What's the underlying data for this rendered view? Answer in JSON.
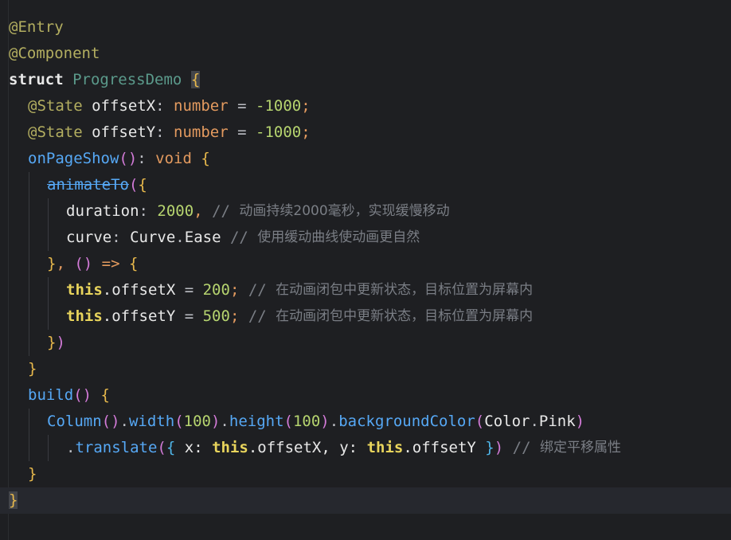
{
  "editor": {
    "theme_colors": {
      "background": "#1e1f22",
      "current_line": "#26282e",
      "annotation": "#b3ae60",
      "keyword": "#cf8e6d",
      "function": "#56a8f5",
      "number": "#b6d46f",
      "comment": "#7a7e85"
    },
    "current_line_number": 19,
    "lines": [
      {
        "tokens": [
          {
            "t": "@Entry",
            "c": "ann"
          }
        ]
      },
      {
        "tokens": [
          {
            "t": "@Component",
            "c": "ann"
          }
        ]
      },
      {
        "tokens": [
          {
            "t": "struct",
            "c": "white-bold"
          },
          {
            "t": " ",
            "c": "id"
          },
          {
            "t": "ProgressDemo",
            "c": "cls"
          },
          {
            "t": " ",
            "c": "id"
          },
          {
            "t": "{",
            "c": "brace-y hl"
          }
        ]
      },
      {
        "indent": 1,
        "tokens": [
          {
            "t": "@State",
            "c": "ann"
          },
          {
            "t": " offsetX",
            "c": "white"
          },
          {
            "t": ": ",
            "c": "op"
          },
          {
            "t": "number",
            "c": "orange"
          },
          {
            "t": " = ",
            "c": "op"
          },
          {
            "t": "-1000",
            "c": "numg"
          },
          {
            "t": ";",
            "c": "orange"
          }
        ]
      },
      {
        "indent": 1,
        "tokens": [
          {
            "t": "@State",
            "c": "ann"
          },
          {
            "t": " offsetY",
            "c": "white"
          },
          {
            "t": ": ",
            "c": "op"
          },
          {
            "t": "number",
            "c": "orange"
          },
          {
            "t": " = ",
            "c": "op"
          },
          {
            "t": "-1000",
            "c": "numg"
          },
          {
            "t": ";",
            "c": "orange"
          }
        ]
      },
      {
        "indent": 1,
        "tokens": [
          {
            "t": "onPageShow",
            "c": "fn"
          },
          {
            "t": "()",
            "c": "brace-p"
          },
          {
            "t": ": ",
            "c": "op"
          },
          {
            "t": "void",
            "c": "orange"
          },
          {
            "t": " ",
            "c": "id"
          },
          {
            "t": "{",
            "c": "brace-y"
          }
        ]
      },
      {
        "indent": 2,
        "tokens": [
          {
            "t": "animateTo",
            "c": "fn strike"
          },
          {
            "t": "(",
            "c": "brace-p"
          },
          {
            "t": "{",
            "c": "brace-y"
          }
        ]
      },
      {
        "indent": 3,
        "tokens": [
          {
            "t": "duration",
            "c": "white"
          },
          {
            "t": ": ",
            "c": "op"
          },
          {
            "t": "2000",
            "c": "numg"
          },
          {
            "t": ", ",
            "c": "orange"
          },
          {
            "t": "// ",
            "c": "cmslash"
          },
          {
            "t": "动画持续2000毫秒，实现缓慢移动",
            "c": "cm"
          }
        ]
      },
      {
        "indent": 3,
        "tokens": [
          {
            "t": "curve",
            "c": "white"
          },
          {
            "t": ": ",
            "c": "op"
          },
          {
            "t": "Curve",
            "c": "white"
          },
          {
            "t": ".",
            "c": "op"
          },
          {
            "t": "Ease",
            "c": "white"
          },
          {
            "t": " ",
            "c": "id"
          },
          {
            "t": "// ",
            "c": "cmslash"
          },
          {
            "t": "使用缓动曲线使动画更自然",
            "c": "cm"
          }
        ]
      },
      {
        "indent": 2,
        "tokens": [
          {
            "t": "}",
            "c": "brace-y"
          },
          {
            "t": ", ",
            "c": "orange"
          },
          {
            "t": "()",
            "c": "brace-p"
          },
          {
            "t": " => ",
            "c": "orange"
          },
          {
            "t": "{",
            "c": "brace-y"
          }
        ]
      },
      {
        "indent": 3,
        "tokens": [
          {
            "t": "this",
            "c": "this"
          },
          {
            "t": ".offsetX",
            "c": "white"
          },
          {
            "t": " = ",
            "c": "op"
          },
          {
            "t": "200",
            "c": "numg"
          },
          {
            "t": "; ",
            "c": "orange"
          },
          {
            "t": "// ",
            "c": "cmslash"
          },
          {
            "t": "在动画闭包中更新状态，目标位置为屏幕内",
            "c": "cm"
          }
        ]
      },
      {
        "indent": 3,
        "tokens": [
          {
            "t": "this",
            "c": "this"
          },
          {
            "t": ".offsetY",
            "c": "white"
          },
          {
            "t": " = ",
            "c": "op"
          },
          {
            "t": "500",
            "c": "numg"
          },
          {
            "t": "; ",
            "c": "orange"
          },
          {
            "t": "// ",
            "c": "cmslash"
          },
          {
            "t": "在动画闭包中更新状态，目标位置为屏幕内",
            "c": "cm"
          }
        ]
      },
      {
        "indent": 2,
        "tokens": [
          {
            "t": "}",
            "c": "brace-y"
          },
          {
            "t": ")",
            "c": "brace-p"
          }
        ]
      },
      {
        "indent": 1,
        "tokens": [
          {
            "t": "}",
            "c": "brace-y"
          }
        ]
      },
      {
        "indent": 1,
        "tokens": [
          {
            "t": "build",
            "c": "fn"
          },
          {
            "t": "()",
            "c": "brace-p"
          },
          {
            "t": " ",
            "c": "id"
          },
          {
            "t": "{",
            "c": "brace-y"
          }
        ]
      },
      {
        "indent": 2,
        "tokens": [
          {
            "t": "Column",
            "c": "fn"
          },
          {
            "t": "()",
            "c": "brace-p"
          },
          {
            "t": ".",
            "c": "op"
          },
          {
            "t": "width",
            "c": "fn"
          },
          {
            "t": "(",
            "c": "brace-p"
          },
          {
            "t": "100",
            "c": "numg"
          },
          {
            "t": ")",
            "c": "brace-p"
          },
          {
            "t": ".",
            "c": "op"
          },
          {
            "t": "height",
            "c": "fn"
          },
          {
            "t": "(",
            "c": "brace-p"
          },
          {
            "t": "100",
            "c": "numg"
          },
          {
            "t": ")",
            "c": "brace-p"
          },
          {
            "t": ".",
            "c": "op"
          },
          {
            "t": "backgroundColor",
            "c": "fn"
          },
          {
            "t": "(",
            "c": "brace-p"
          },
          {
            "t": "Color",
            "c": "white"
          },
          {
            "t": ".",
            "c": "op"
          },
          {
            "t": "Pink",
            "c": "white"
          },
          {
            "t": ")",
            "c": "brace-p"
          }
        ]
      },
      {
        "indent": 3,
        "tokens": [
          {
            "t": ".",
            "c": "op"
          },
          {
            "t": "translate",
            "c": "fn"
          },
          {
            "t": "(",
            "c": "brace-p"
          },
          {
            "t": "{",
            "c": "brace-b"
          },
          {
            "t": " x: ",
            "c": "white"
          },
          {
            "t": "this",
            "c": "this"
          },
          {
            "t": ".offsetX",
            "c": "white"
          },
          {
            "t": ", y: ",
            "c": "white"
          },
          {
            "t": "this",
            "c": "this"
          },
          {
            "t": ".offsetY",
            "c": "white"
          },
          {
            "t": " ",
            "c": "id"
          },
          {
            "t": "}",
            "c": "brace-b"
          },
          {
            "t": ")",
            "c": "brace-p"
          },
          {
            "t": " ",
            "c": "id"
          },
          {
            "t": "// ",
            "c": "cmslash"
          },
          {
            "t": "绑定平移属性",
            "c": "cm"
          }
        ]
      },
      {
        "indent": 1,
        "tokens": [
          {
            "t": "}",
            "c": "brace-y"
          }
        ]
      },
      {
        "tokens": [
          {
            "t": "}",
            "c": "brace-y hl"
          }
        ]
      }
    ]
  }
}
